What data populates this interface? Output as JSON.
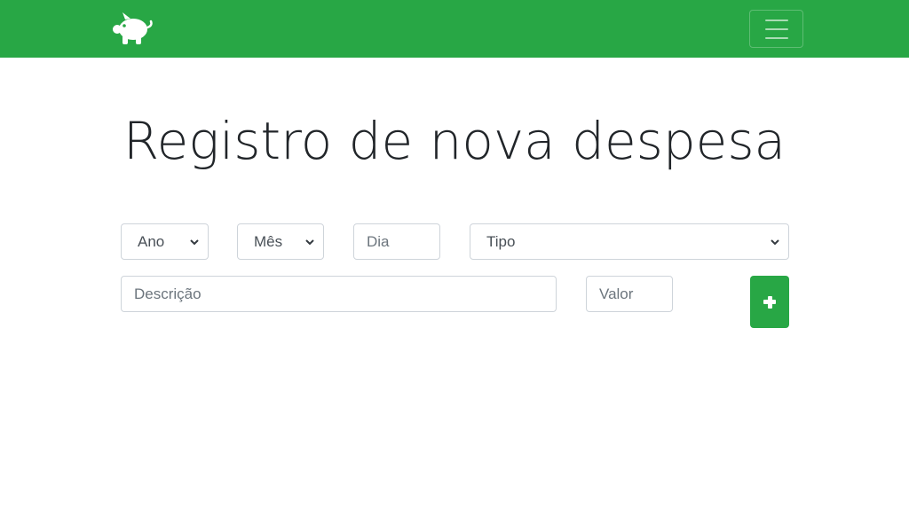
{
  "colors": {
    "brand": "#28a745",
    "text": "#212529",
    "border": "#ced4da",
    "placeholder": "#6c757d"
  },
  "header": {
    "logo_icon": "piggy-bank-icon",
    "menu_icon": "hamburger-menu-icon"
  },
  "main": {
    "title": "Registro de nova despesa",
    "form": {
      "ano_select": {
        "value": "Ano"
      },
      "mes_select": {
        "value": "Mês"
      },
      "dia_input": {
        "placeholder": "Dia"
      },
      "tipo_select": {
        "value": "Tipo"
      },
      "descricao_input": {
        "placeholder": "Descrição"
      },
      "valor_input": {
        "placeholder": "Valor"
      },
      "add_button_icon": "plus-icon"
    }
  }
}
